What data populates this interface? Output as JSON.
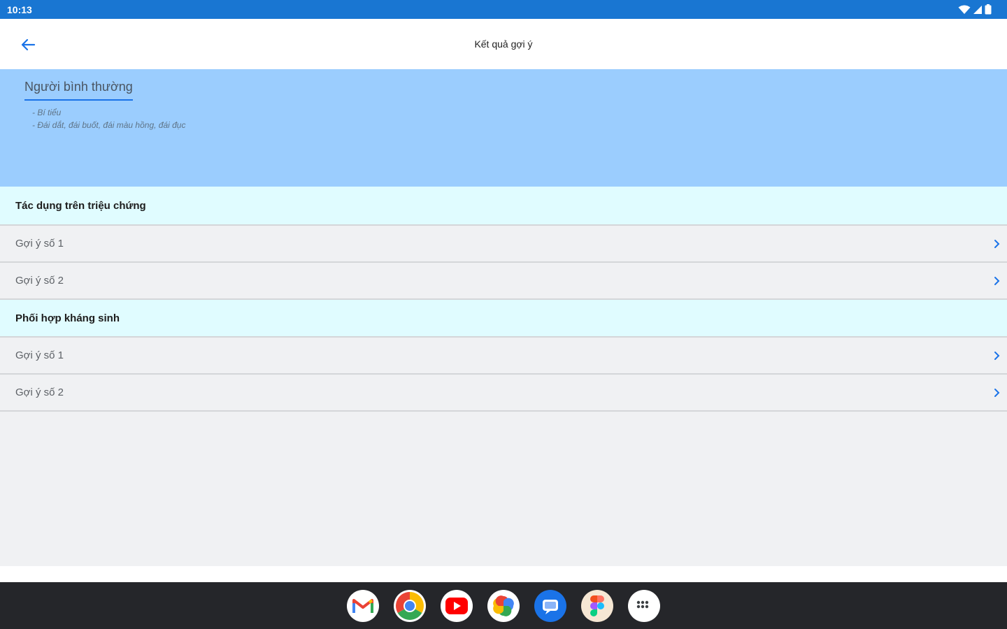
{
  "status_bar": {
    "time": "10:13",
    "icons": [
      "wifi-icon",
      "signal-icon",
      "battery-icon"
    ]
  },
  "app_bar": {
    "title": "Kết quả gợi ý",
    "back_icon": "arrow-left-icon"
  },
  "hero": {
    "title": "Người bình thường",
    "lines": [
      "- Bí tiểu",
      "- Đái dắt, đái buốt, đái màu hồng, đái đục"
    ]
  },
  "sections": [
    {
      "header": "Tác dụng trên triệu chứng",
      "items": [
        {
          "label": "Gợi ý số 1"
        },
        {
          "label": "Gợi ý số 2"
        }
      ]
    },
    {
      "header": "Phối hợp kháng sinh",
      "items": [
        {
          "label": "Gợi ý số 1"
        },
        {
          "label": "Gợi ý số 2"
        }
      ]
    }
  ],
  "dock": {
    "apps": [
      "gmail-icon",
      "chrome-icon",
      "youtube-icon",
      "photos-icon",
      "messages-icon",
      "figma-icon",
      "app-drawer-icon"
    ]
  },
  "colors": {
    "status_bar": "#1976d2",
    "hero": "#9bcdfe",
    "section_header": "#e0fcff",
    "list_bg": "#f0f1f3",
    "accent": "#1a73e8",
    "dock": "#25262a"
  }
}
